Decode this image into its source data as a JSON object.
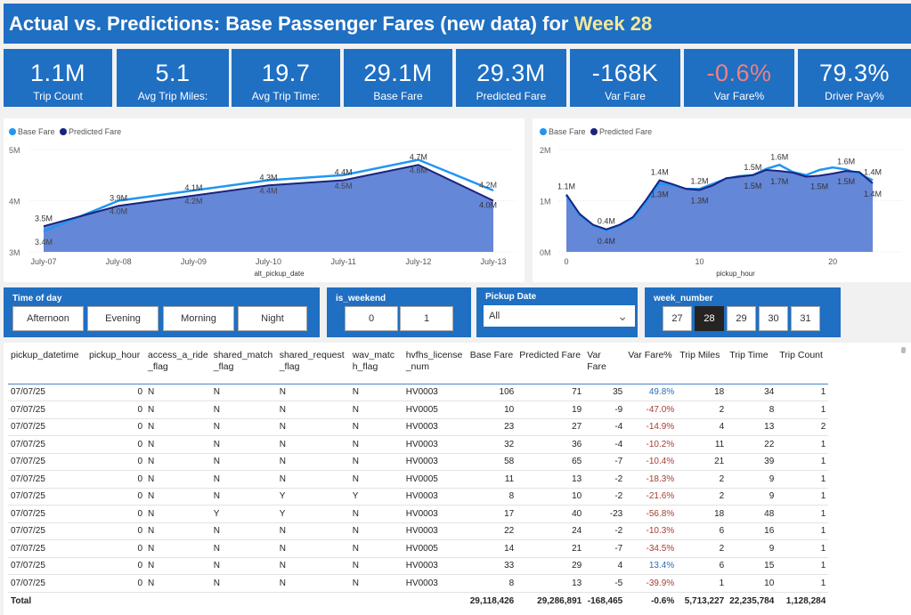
{
  "title": {
    "prefix": "Actual vs. Predictions: Base Passenger Fares (new data) for ",
    "week": "Week 28"
  },
  "kpis": [
    {
      "value": "1.1M",
      "label": "Trip Count"
    },
    {
      "value": "5.1",
      "label": "Avg Trip Miles:"
    },
    {
      "value": "19.7",
      "label": "Avg Trip Time:"
    },
    {
      "value": "29.1M",
      "label": "Base Fare"
    },
    {
      "value": "29.3M",
      "label": "Predicted Fare"
    },
    {
      "value": "-168K",
      "label": "Var Fare"
    },
    {
      "value": "-0.6%",
      "label": "Var Fare%"
    },
    {
      "value": "79.3%",
      "label": "Driver Pay%"
    }
  ],
  "colors": {
    "title_bg": "#1f6fc2",
    "base_fare": "#2196f3",
    "predicted_fare": "#1a237e",
    "area_fill": "#4a72d1",
    "negative": "#a63d33",
    "positive": "#2a6db5"
  },
  "legend": {
    "base": "Base Fare",
    "predicted": "Predicted Fare"
  },
  "chart_data": [
    {
      "type": "area",
      "xlabel": "alt_pickup_date",
      "ylabel": "",
      "categories": [
        "July-07",
        "July-08",
        "July-09",
        "July-10",
        "July-11",
        "July-12",
        "July-13"
      ],
      "yticks": [
        "3M",
        "4M",
        "5M"
      ],
      "ylim": [
        3000000,
        5000000
      ],
      "grid": true,
      "legend_position": "top-left",
      "series": [
        {
          "name": "Base Fare",
          "values": [
            3400000,
            4000000,
            4200000,
            4400000,
            4500000,
            4800000,
            4200000
          ],
          "labels": [
            "3.4M",
            "4.0M",
            "4.2M",
            "4.4M",
            "4.5M",
            "4.8M",
            "4.2M"
          ]
        },
        {
          "name": "Predicted Fare",
          "values": [
            3500000,
            3900000,
            4100000,
            4300000,
            4400000,
            4700000,
            4000000
          ],
          "labels": [
            "3.5M",
            "3.9M",
            "4.1M",
            "4.3M",
            "4.4M",
            "4.7M",
            "4.0M"
          ]
        }
      ]
    },
    {
      "type": "area",
      "xlabel": "pickup_hour",
      "ylabel": "",
      "xticks": [
        "0",
        "10",
        "20"
      ],
      "x": [
        0,
        1,
        2,
        3,
        4,
        5,
        6,
        7,
        8,
        9,
        10,
        11,
        12,
        13,
        14,
        15,
        16,
        17,
        18,
        19,
        20,
        21,
        22,
        23
      ],
      "yticks": [
        "0M",
        "1M",
        "2M"
      ],
      "ylim": [
        0,
        2000000
      ],
      "grid": true,
      "legend_position": "top-left",
      "series": [
        {
          "name": "Base Fare",
          "values": [
            1100000,
            720000,
            520000,
            420000,
            520000,
            650000,
            980000,
            1330000,
            1300000,
            1230000,
            1230000,
            1330000,
            1430000,
            1480000,
            1500000,
            1620000,
            1700000,
            1560000,
            1500000,
            1600000,
            1650000,
            1610000,
            1520000,
            1400000
          ]
        },
        {
          "name": "Predicted Fare",
          "values": [
            1120000,
            740000,
            530000,
            440000,
            530000,
            680000,
            1020000,
            1400000,
            1320000,
            1230000,
            1210000,
            1300000,
            1440000,
            1470000,
            1500000,
            1600000,
            1580000,
            1550000,
            1470000,
            1490000,
            1530000,
            1580000,
            1560000,
            1340000
          ]
        }
      ],
      "annotations": [
        {
          "x": 0,
          "text": "1.1M",
          "pos": "above"
        },
        {
          "x": 3,
          "text": "0.4M",
          "pos": "above"
        },
        {
          "x": 3,
          "text": "0.4M",
          "pos": "below"
        },
        {
          "x": 7,
          "text": "1.4M",
          "pos": "above"
        },
        {
          "x": 7,
          "text": "1.3M",
          "pos": "below"
        },
        {
          "x": 10,
          "text": "1.2M",
          "pos": "above"
        },
        {
          "x": 10,
          "text": "1.3M",
          "pos": "below"
        },
        {
          "x": 14,
          "text": "1.5M",
          "pos": "above"
        },
        {
          "x": 14,
          "text": "1.5M",
          "pos": "below"
        },
        {
          "x": 16,
          "text": "1.6M",
          "pos": "above"
        },
        {
          "x": 16,
          "text": "1.7M",
          "pos": "below"
        },
        {
          "x": 19,
          "text": "1.5M",
          "pos": "below"
        },
        {
          "x": 21,
          "text": "1.6M",
          "pos": "above"
        },
        {
          "x": 21,
          "text": "1.5M",
          "pos": "below"
        },
        {
          "x": 23,
          "text": "1.4M",
          "pos": "above"
        },
        {
          "x": 23,
          "text": "1.4M",
          "pos": "below"
        }
      ]
    }
  ],
  "slicers": {
    "time_of_day": {
      "title": "Time of day",
      "options": [
        "Afternoon",
        "Evening",
        "Morning",
        "Night"
      ]
    },
    "is_weekend": {
      "title": "is_weekend",
      "options": [
        "0",
        "1"
      ]
    },
    "pickup_date": {
      "title": "Pickup Date",
      "value": "All"
    },
    "week_number": {
      "title": "week_number",
      "options": [
        "27",
        "28",
        "29",
        "30",
        "31"
      ],
      "selected": "28"
    }
  },
  "table": {
    "columns": [
      "pickup_datetime",
      "pickup_hour",
      "access_a_ride\n_flag",
      "shared_match\n_flag",
      "shared_request\n_flag",
      "wav_matc\nh_flag",
      "hvfhs_license\n_num",
      "Base Fare",
      "Predicted Fare",
      "Var Fare",
      "Var Fare%",
      "Trip Miles",
      "Trip Time",
      "Trip Count"
    ],
    "rows": [
      [
        "07/07/25",
        "0",
        "N",
        "N",
        "N",
        "N",
        "HV0003",
        "106",
        "71",
        "35",
        "49.8%",
        "18",
        "34",
        "1"
      ],
      [
        "07/07/25",
        "0",
        "N",
        "N",
        "N",
        "N",
        "HV0005",
        "10",
        "19",
        "-9",
        "-47.0%",
        "2",
        "8",
        "1"
      ],
      [
        "07/07/25",
        "0",
        "N",
        "N",
        "N",
        "N",
        "HV0003",
        "23",
        "27",
        "-4",
        "-14.9%",
        "4",
        "13",
        "2"
      ],
      [
        "07/07/25",
        "0",
        "N",
        "N",
        "N",
        "N",
        "HV0003",
        "32",
        "36",
        "-4",
        "-10.2%",
        "11",
        "22",
        "1"
      ],
      [
        "07/07/25",
        "0",
        "N",
        "N",
        "N",
        "N",
        "HV0003",
        "58",
        "65",
        "-7",
        "-10.4%",
        "21",
        "39",
        "1"
      ],
      [
        "07/07/25",
        "0",
        "N",
        "N",
        "N",
        "N",
        "HV0005",
        "11",
        "13",
        "-2",
        "-18.3%",
        "2",
        "9",
        "1"
      ],
      [
        "07/07/25",
        "0",
        "N",
        "N",
        "Y",
        "Y",
        "HV0003",
        "8",
        "10",
        "-2",
        "-21.6%",
        "2",
        "9",
        "1"
      ],
      [
        "07/07/25",
        "0",
        "N",
        "Y",
        "Y",
        "N",
        "HV0003",
        "17",
        "40",
        "-23",
        "-56.8%",
        "18",
        "48",
        "1"
      ],
      [
        "07/07/25",
        "0",
        "N",
        "N",
        "N",
        "N",
        "HV0003",
        "22",
        "24",
        "-2",
        "-10.3%",
        "6",
        "16",
        "1"
      ],
      [
        "07/07/25",
        "0",
        "N",
        "N",
        "N",
        "N",
        "HV0005",
        "14",
        "21",
        "-7",
        "-34.5%",
        "2",
        "9",
        "1"
      ],
      [
        "07/07/25",
        "0",
        "N",
        "N",
        "N",
        "N",
        "HV0003",
        "33",
        "29",
        "4",
        "13.4%",
        "6",
        "15",
        "1"
      ],
      [
        "07/07/25",
        "0",
        "N",
        "N",
        "N",
        "N",
        "HV0003",
        "8",
        "13",
        "-5",
        "-39.9%",
        "1",
        "10",
        "1"
      ]
    ],
    "total": [
      "Total",
      "",
      "",
      "",
      "",
      "",
      "",
      "29,118,426",
      "29,286,891",
      "-168,465",
      "-0.6%",
      "5,713,227",
      "22,235,784",
      "1,128,284"
    ]
  }
}
